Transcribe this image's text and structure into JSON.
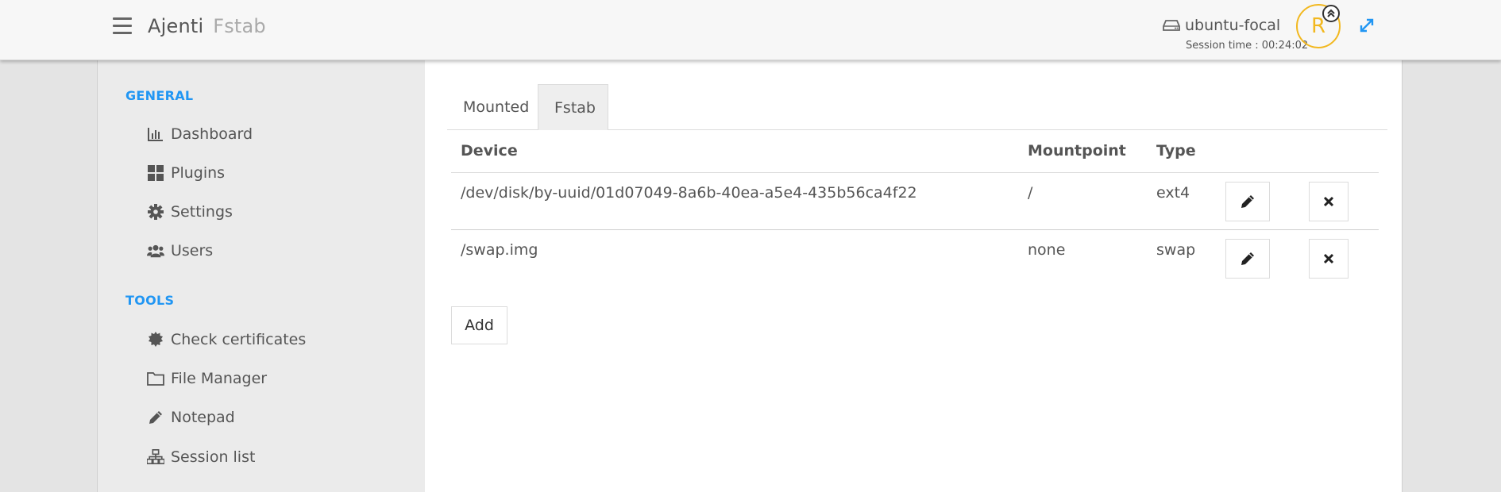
{
  "header": {
    "app_name": "Ajenti",
    "plugin_name": "Fstab",
    "hostname": "ubuntu-focal",
    "session_time": "Session time : 00:24:02",
    "avatar_letter": "R",
    "icons": [
      "hamburger-icon",
      "hard-drive-icon",
      "chevron-up-icon",
      "expand-icon"
    ]
  },
  "sidebar": {
    "general_title": "GENERAL",
    "general_items": [
      {
        "label": "Dashboard",
        "icon": "bar-chart-icon"
      },
      {
        "label": "Plugins",
        "icon": "grid-icon"
      },
      {
        "label": "Settings",
        "icon": "gear-icon"
      },
      {
        "label": "Users",
        "icon": "users-icon"
      }
    ],
    "tools_title": "TOOLS",
    "tools_items": [
      {
        "label": "Check certificates",
        "icon": "certificate-icon"
      },
      {
        "label": "File Manager",
        "icon": "folder-icon"
      },
      {
        "label": "Notepad",
        "icon": "pencil-icon"
      },
      {
        "label": "Session list",
        "icon": "sitemap-icon"
      }
    ]
  },
  "main": {
    "tabs": [
      {
        "label": "Mounted",
        "active": false
      },
      {
        "label": "Fstab",
        "active": true
      }
    ],
    "table": {
      "headers": [
        "Device",
        "Mountpoint",
        "Type"
      ],
      "rows": [
        {
          "device": "/dev/disk/by-uuid/01d07049-8a6b-40ea-a5e4-435b56ca4f22",
          "mountpoint": "/",
          "type": "ext4"
        },
        {
          "device": "/swap.img",
          "mountpoint": "none",
          "type": "swap"
        }
      ]
    },
    "add_label": "Add"
  },
  "colors": {
    "accent": "#2196f3",
    "avatar": "#f2b81f"
  }
}
